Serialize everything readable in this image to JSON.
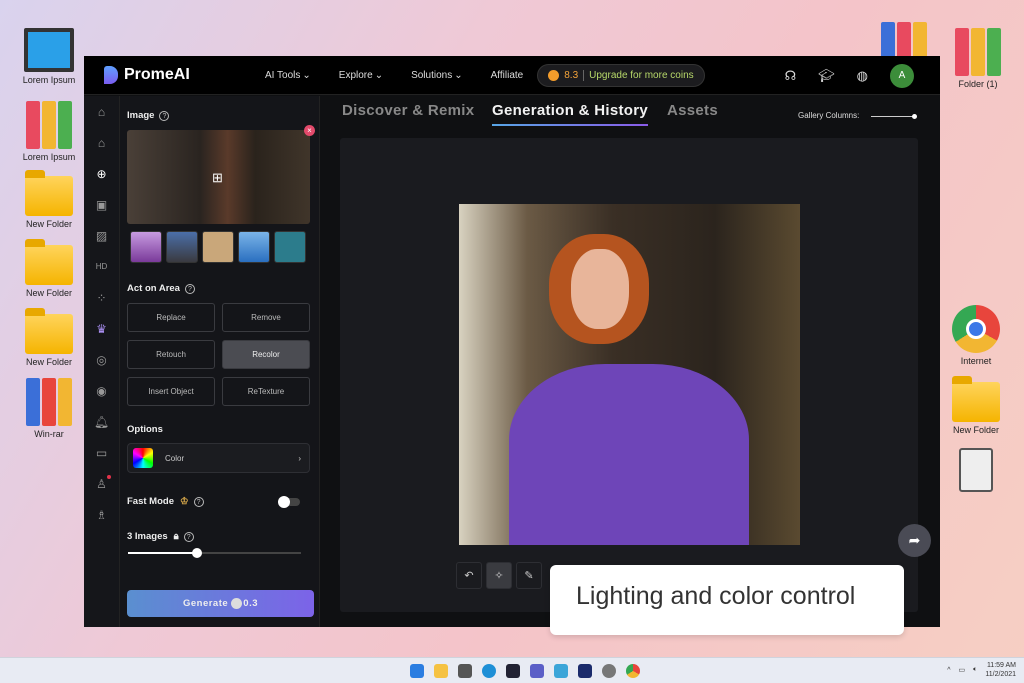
{
  "desktop": {
    "left_icons": [
      "Lorem Ipsum",
      "Lorem Ipsum",
      "New Folder",
      "New Folder",
      "New Folder",
      "Win-rar"
    ],
    "right_icons": [
      "Folder (1)",
      "Internet",
      "New Folder"
    ]
  },
  "app": {
    "brand": "PromeAI",
    "nav": [
      "AI Tools",
      "Explore",
      "Solutions",
      "Affiliate"
    ],
    "coins": "8.3",
    "upgrade": "Upgrade for more coins",
    "avatar": "A"
  },
  "panel": {
    "image_label": "Image",
    "act_label": "Act on Area",
    "actions": [
      "Replace",
      "Remove",
      "Retouch",
      "Recolor",
      "Insert Object",
      "ReTexture"
    ],
    "selected_action": "Recolor",
    "options_label": "Options",
    "option_value": "Color",
    "fast_mode": "Fast Mode",
    "fast_mode_on": false,
    "images_label": "3 Images",
    "images_slider": 0.4,
    "generate": "Generate",
    "generate_cost": "0.3"
  },
  "main": {
    "tabs": [
      "Discover & Remix",
      "Generation & History",
      "Assets"
    ],
    "active_tab": "Generation & History",
    "gallery_columns": "Gallery Columns:"
  },
  "caption": "Lighting and color control",
  "taskbar": {
    "time": "11:59 AM",
    "date": "11/2/2021"
  }
}
